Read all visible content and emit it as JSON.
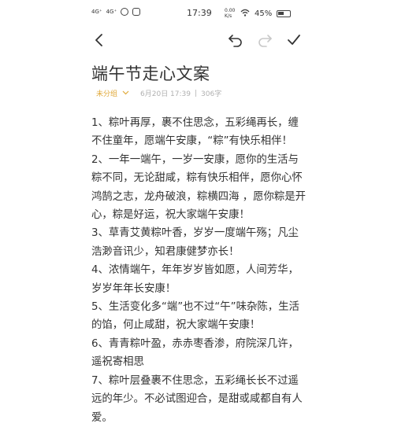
{
  "status_bar": {
    "network_1": "4G⁺",
    "network_2": "4G⁺",
    "time": "17:39",
    "data_speed": "0.00 K/s",
    "battery": "45%"
  },
  "toolbar": {
    "back_icon": "chevron-left-icon",
    "undo_icon": "undo-icon",
    "redo_icon": "redo-icon",
    "done_icon": "check-icon"
  },
  "note": {
    "title": "端午节走心文案",
    "category": "未分组",
    "date": "6月20日 17:39",
    "separator": "|",
    "word_count": "306字",
    "paragraphs": [
      "1、粽叶再厚，裹不住思念，五彩绳再长，缠不住童年，愿端午安康，“粽”有快乐相伴！",
      "2、一年一端午，一岁一安康，愿你的生活与粽不同，无论甜咸，粽有快乐相伴，愿你心怀鸿鹄之志，龙舟破浪，粽横四海 ，愿你粽是开心，粽是好运，祝大家端午安康！",
      "3、草青艾黄粽叶香，岁岁一度端午殇；凡尘浩渺音讯少，知君康健梦亦长！",
      "4、浓情端午，年年岁岁皆如愿，人间芳华，岁岁年年长安康！",
      "5、生活变化多“端”也不过“午”味杂陈，生活的馅，何止咸甜，祝大家端午安康！",
      "6、青青粽叶盈，赤赤枣香渗，府院深几许，遥祝寄相思",
      "7、粽叶层叠裹不住思念，五彩绳长长不过遥远的年少。不必试图迎合，是甜或咸都自有人爱。"
    ]
  }
}
